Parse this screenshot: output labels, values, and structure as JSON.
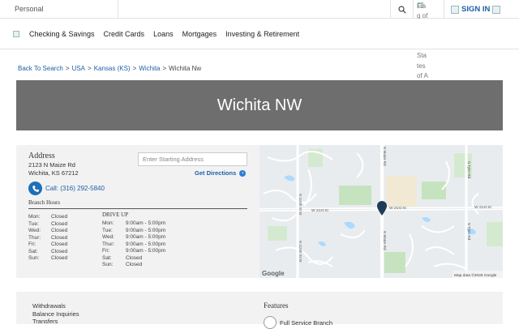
{
  "topbar": {
    "personal_label": "Personal",
    "flag_alt": "Flag of the United States of America",
    "signin_label": "SIGN IN",
    "icons": [
      "search-icon",
      "broken-image-icon"
    ]
  },
  "nav": {
    "items": [
      {
        "label": "Checking & Savings"
      },
      {
        "label": "Credit Cards"
      },
      {
        "label": "Loans"
      },
      {
        "label": "Mortgages"
      },
      {
        "label": "Investing & Retirement"
      }
    ]
  },
  "breadcrumb": {
    "items": [
      "Back To Search",
      "USA",
      "Kansas (KS)",
      "Wichita"
    ],
    "current": "Wichita Nw",
    "separator": ">"
  },
  "hero": {
    "title": "Wichita NW",
    "background": "#6e6e6e"
  },
  "location": {
    "address_heading": "Address",
    "address_line1": "2123 N Maize Rd",
    "address_line2": "Wichita, KS 67212",
    "start_placeholder": "Enter Starting Address",
    "get_directions": "Get Directions",
    "call_label": "Call: (316) 292-5840",
    "branch_hours_heading": "Branch Hours",
    "drive_up_heading": "DRIVE UP",
    "branch_hours": [
      {
        "day": "Mon:",
        "hours": "Closed"
      },
      {
        "day": "Tue:",
        "hours": "Closed"
      },
      {
        "day": "Wed:",
        "hours": "Closed"
      },
      {
        "day": "Thur:",
        "hours": "Closed"
      },
      {
        "day": "Fri:",
        "hours": "Closed"
      },
      {
        "day": "Sat:",
        "hours": "Closed"
      },
      {
        "day": "Sun:",
        "hours": "Closed"
      }
    ],
    "drive_up_hours": [
      {
        "day": "Mon:",
        "hours": "9:00am - 5:00pm"
      },
      {
        "day": "Tue:",
        "hours": "9:00am - 5:00pm"
      },
      {
        "day": "Wed:",
        "hours": "9:00am - 5:00pm"
      },
      {
        "day": "Thur:",
        "hours": "9:00am - 5:00pm"
      },
      {
        "day": "Fri:",
        "hours": "9:00am - 5:00pm"
      },
      {
        "day": "Sat:",
        "hours": "Closed"
      },
      {
        "day": "Sun:",
        "hours": "Closed"
      }
    ]
  },
  "map": {
    "street_labels": {
      "w21": "W 21st St",
      "maize": "N Maize Rd",
      "n119": "N 119th St W",
      "tyler": "N Tyler Rd"
    },
    "google_logo": "Google",
    "attribution": "Map data ©2026 Google",
    "pin_color": "#1f3b57"
  },
  "lower": {
    "services": [
      "Withdrawals",
      "Balance Inquiries",
      "Transfers"
    ],
    "features_heading": "Features",
    "features": [
      "Full Service Branch"
    ]
  },
  "colors": {
    "link": "#1f5fa6",
    "panel": "#f2f2f2"
  }
}
